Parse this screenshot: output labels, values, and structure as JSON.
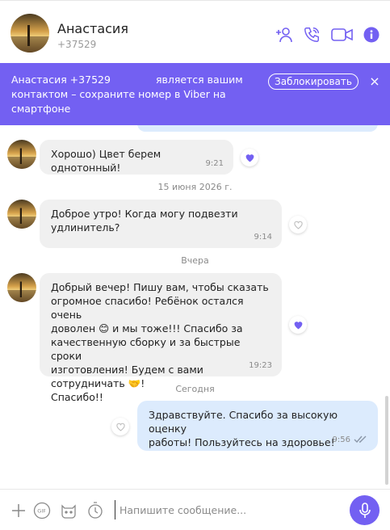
{
  "colors": {
    "accent": "#7360f2",
    "incoming_bubble": "#f0f0f0",
    "outgoing_bubble": "#dcebfd"
  },
  "header": {
    "name": "Анастасия",
    "phone": "+37529",
    "icons": [
      "add-contact-icon",
      "phone-icon",
      "video-icon",
      "info-icon"
    ]
  },
  "banner": {
    "line_start": "Анастасия +37529",
    "line_rest": "является вашим контактом – сохраните номер в Viber на смартфоне",
    "block_label": "Заблокировать",
    "close_label": "×"
  },
  "messages": [
    {
      "text": "Хорошо) Цвет берем однотонный!",
      "time": "9:21",
      "liked": true
    },
    {
      "text": "Доброе утро! Когда могу подвезти\nудлинитель?",
      "time": "9:14",
      "liked": false
    },
    {
      "text": "Добрый вечер! Пишу вам, чтобы сказать\nогромное спасибо! Ребёнок остался очень\nдоволен 😊 и мы тоже!!! Спасибо за\nкачественную сборку и за быстрые сроки\nизготовления! Будем с вами сотрудничать 🤝!\nСпасибо!!",
      "time": "19:23",
      "liked": true
    },
    {
      "text": "Здравствуйте. Спасибо за высокую оценку\nработы! Пользуйтесь на здоровье!",
      "time": "9:56",
      "liked": false,
      "read": true
    }
  ],
  "date_separators": [
    "15 июня 2026 г.",
    "Вчера",
    "Сегодня"
  ],
  "composer": {
    "placeholder": "Напишите сообщение...",
    "icons": [
      "plus-icon",
      "gif-icon",
      "sticker-icon",
      "timer-icon",
      "microphone-icon"
    ]
  }
}
